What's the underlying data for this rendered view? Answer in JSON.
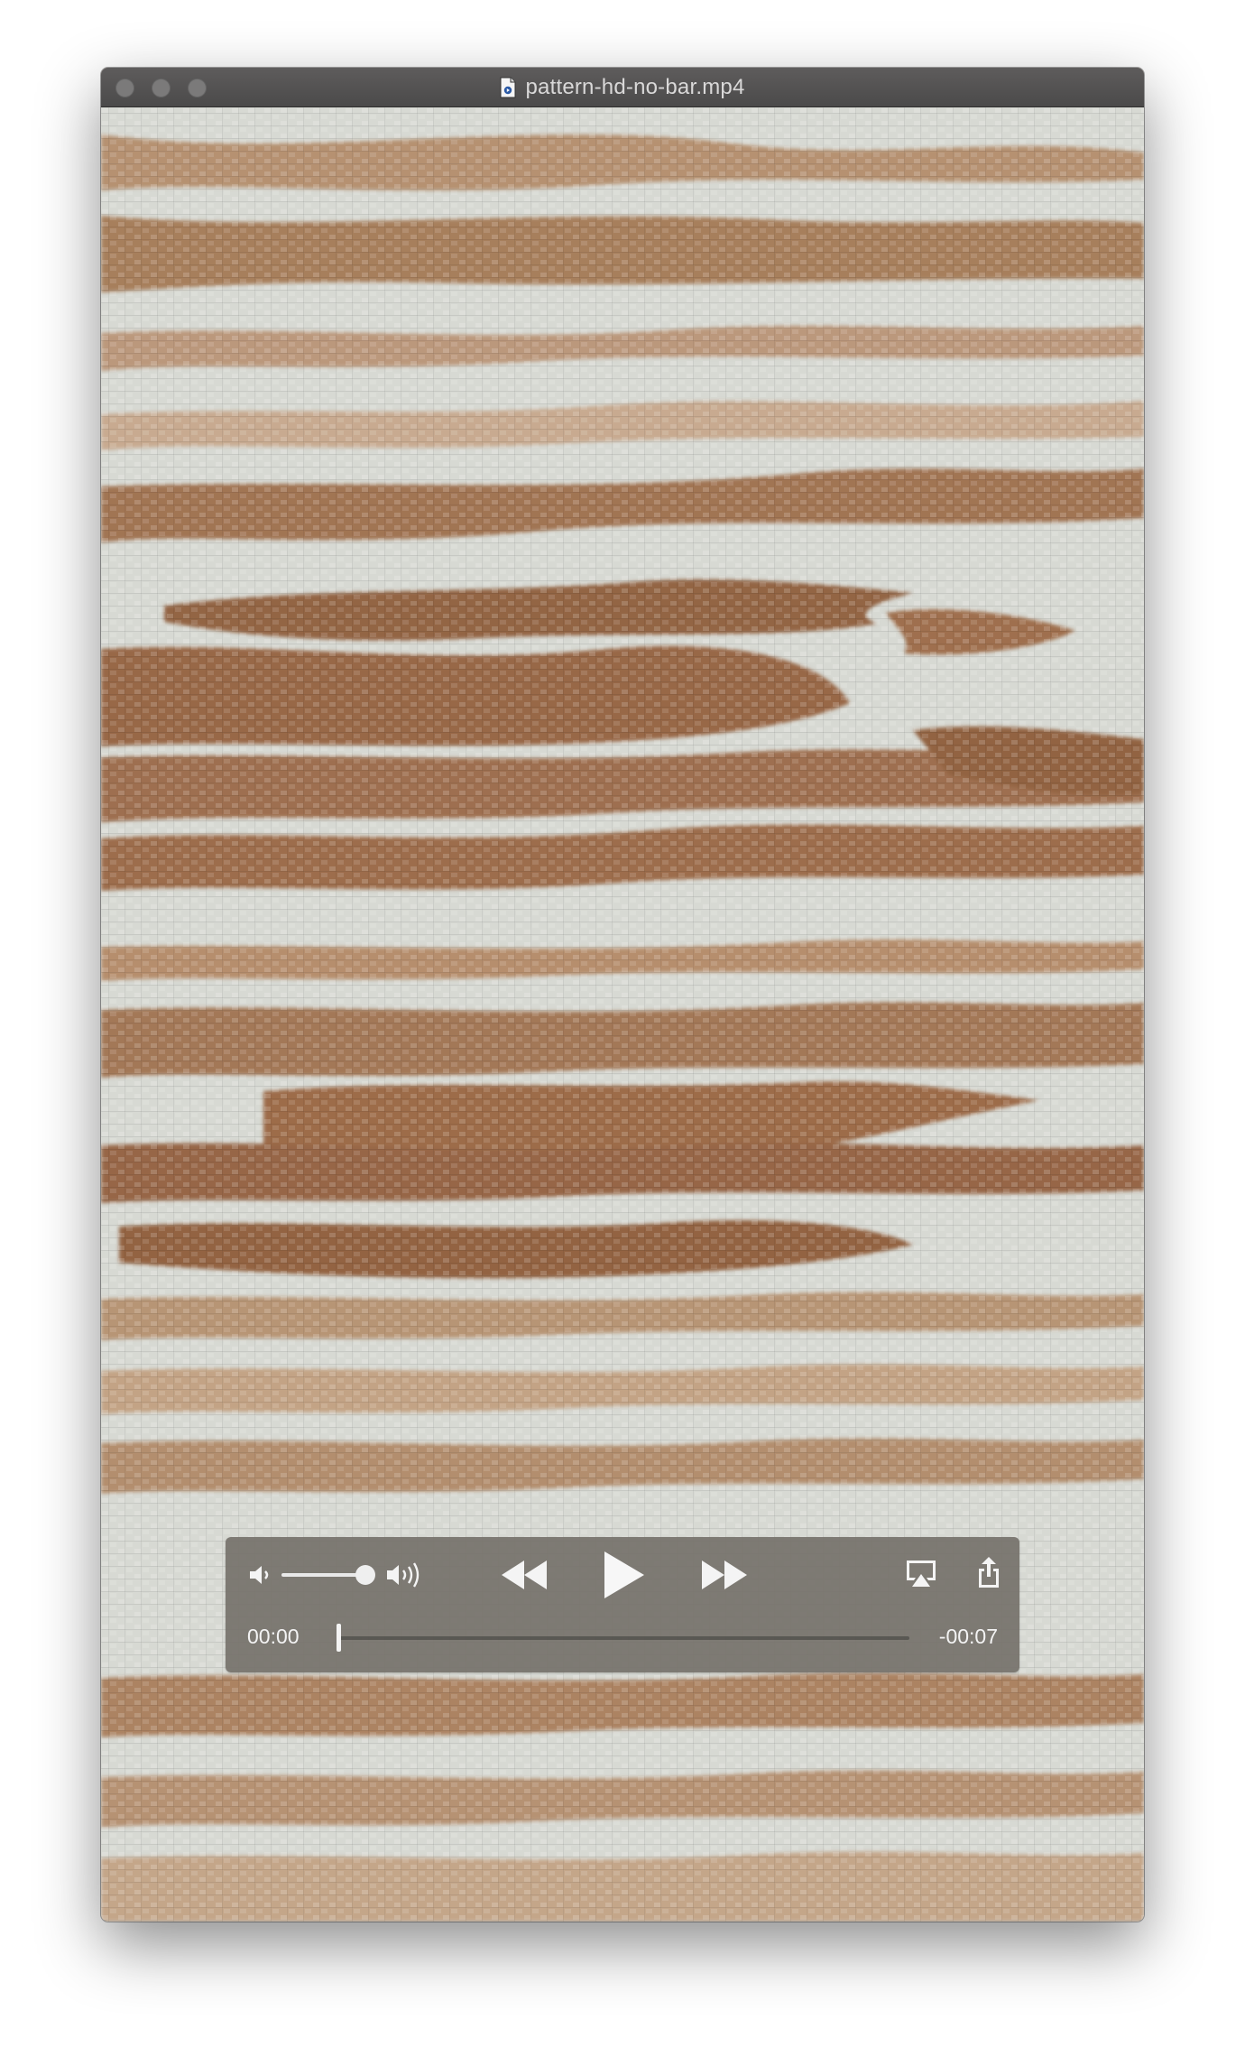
{
  "window": {
    "title": "pattern-hd-no-bar.mp4"
  },
  "player": {
    "elapsed": "00:00",
    "remaining": "-00:07",
    "progress_fraction": 0.0,
    "volume_fraction": 0.88
  },
  "icons": {
    "file": "video-file-icon",
    "volume_low": "speaker-low-icon",
    "volume_high": "speaker-high-icon",
    "rewind": "rewind-icon",
    "play": "play-icon",
    "fast_forward": "fast-forward-icon",
    "airplay": "airplay-icon",
    "share": "share-icon"
  },
  "colors": {
    "fabric_light": "#d9dcd6",
    "fabric_brown": "#9c6c4a",
    "control_bg": "#76726c",
    "titlebar": "#535252"
  }
}
